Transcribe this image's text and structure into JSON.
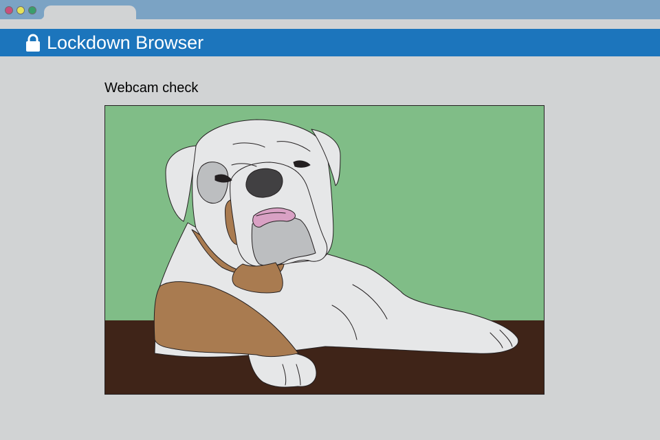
{
  "window": {
    "controls": [
      "close",
      "minimize",
      "maximize"
    ],
    "control_colors": {
      "close": "#c94f7c",
      "minimize": "#e6e35a",
      "maximize": "#3a9e6b"
    }
  },
  "app": {
    "title": "Lockdown Browser",
    "icon": "lock-icon",
    "bar_color": "#1c75bc"
  },
  "main": {
    "section_title": "Webcam check",
    "video": {
      "subject": "bulldog",
      "wall_color": "#80bd87",
      "floor_color": "#3f2418"
    }
  }
}
